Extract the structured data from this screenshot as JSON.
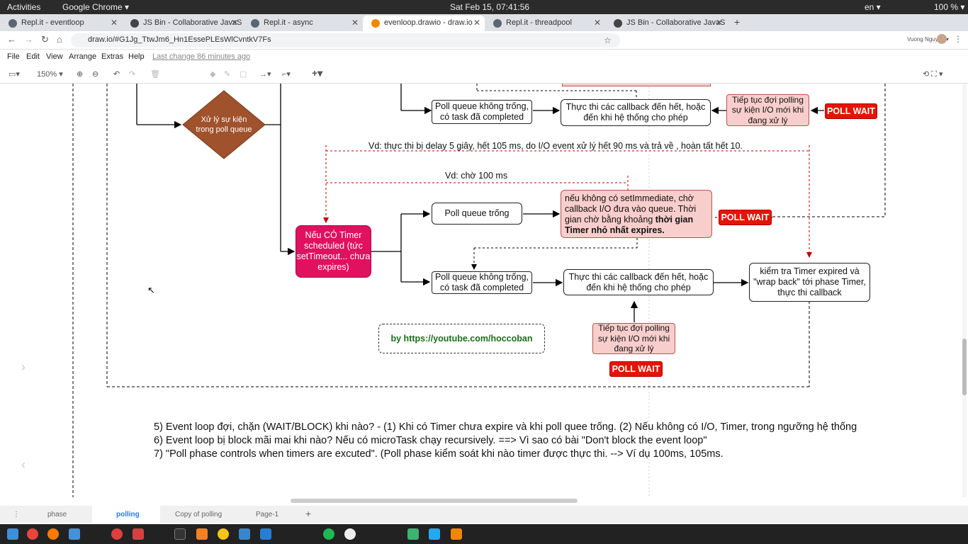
{
  "system_bar": {
    "activities": "Activities",
    "app": "Google Chrome ▾",
    "clock": "Sat Feb 15, 07:41:56",
    "lang": "en ▾",
    "battery": "100 % ▾"
  },
  "browser_tabs": [
    {
      "label": "Repl.it - eventloop",
      "color": "#5b6770"
    },
    {
      "label": "JS Bin - Collaborative JavaS",
      "color": "#444"
    },
    {
      "label": "Repl.it - async",
      "color": "#5b6770"
    },
    {
      "label": "evenloop.drawio - draw.io",
      "color": "#f08705"
    },
    {
      "label": "Repl.it - threadpool",
      "color": "#5b6770"
    },
    {
      "label": "JS Bin - Collaborative JavaS",
      "color": "#444"
    }
  ],
  "url": "draw.io/#G1Jg_TtwJm6_Hn1EssePLEsWlCvntkV7Fs",
  "profile": "Vuong Nguyen ▾",
  "menu": {
    "file": "File",
    "edit": "Edit",
    "view": "View",
    "arrange": "Arrange",
    "extras": "Extras",
    "help": "Help",
    "last_change": "Last change 86 minutes ago"
  },
  "toolbar": {
    "zoom": "150% ▾"
  },
  "diagram": {
    "diamond": "Xử lý sự kiện trong poll queue",
    "top_row": {
      "poll_not_empty": "Poll queue không trống, có task đã completed",
      "exec_callbacks": "Thực thi các callback đến hết, hoặc đến khi hệ thống cho phép",
      "continue_wait": "Tiếp tục đợi polling sự kiện I/O mới khi đang xử lý",
      "poll_wait": "POLL WAIT"
    },
    "label_delay": "Vd: thực thi bị delay 5 giây, hết 105 ms, do I/O event xử lý hết 90 ms và trả về , hoàn tất hết 10.",
    "label_wait": "Vd: chờ 100 ms",
    "timer_box": "Nếu CÓ Timer scheduled (tức setTimeout... chưa expires)",
    "poll_empty": "Poll queue trống",
    "no_immediate": "nếu không có setImmediate, chờ callback I/O đưa vào queue. Thời gian chờ bằng khoảng",
    "no_immediate_bold": "thời gian Timer nhỏ nhất expires.",
    "poll_wait_mid": "POLL WAIT",
    "poll_not_empty2": "Poll queue không trống, có task đã completed",
    "exec_callbacks2": "Thực thi các callback đến hết, hoặc đến khi hệ thống cho phép",
    "check_timer": "kiểm tra Timer expired và \"wrap back\" tới phase Timer, thực thi callback",
    "credit": "by https://youtube.com/hoccoban",
    "continue_wait2": "Tiếp tục đợi polling sự kiện I/O mới khi đang xử lý",
    "poll_wait_bottom": "POLL WAIT"
  },
  "notes": [
    "5) Event loop đợi, chặn (WAIT/BLOCK) khi nào? - (1) Khi có Timer chưa expire và khi poll quee trống. (2) Nếu không có I/O, Timer, trong ngưỡng hệ thống",
    "6) Event loop bị block mãi mai khi nào? Nếu có microTask chạy recursively. ==> Vì sao có bài \"Don't block the event loop\"",
    "7) \"Poll phase controls when timers are excuted\". (Poll phase kiểm soát khi nào timer được thực thi. --> Ví dụ 100ms, 105ms."
  ],
  "pages": {
    "p1": "phase",
    "p2": "polling",
    "p3": "Copy of polling",
    "p4": "Page-1",
    "add": "+"
  }
}
